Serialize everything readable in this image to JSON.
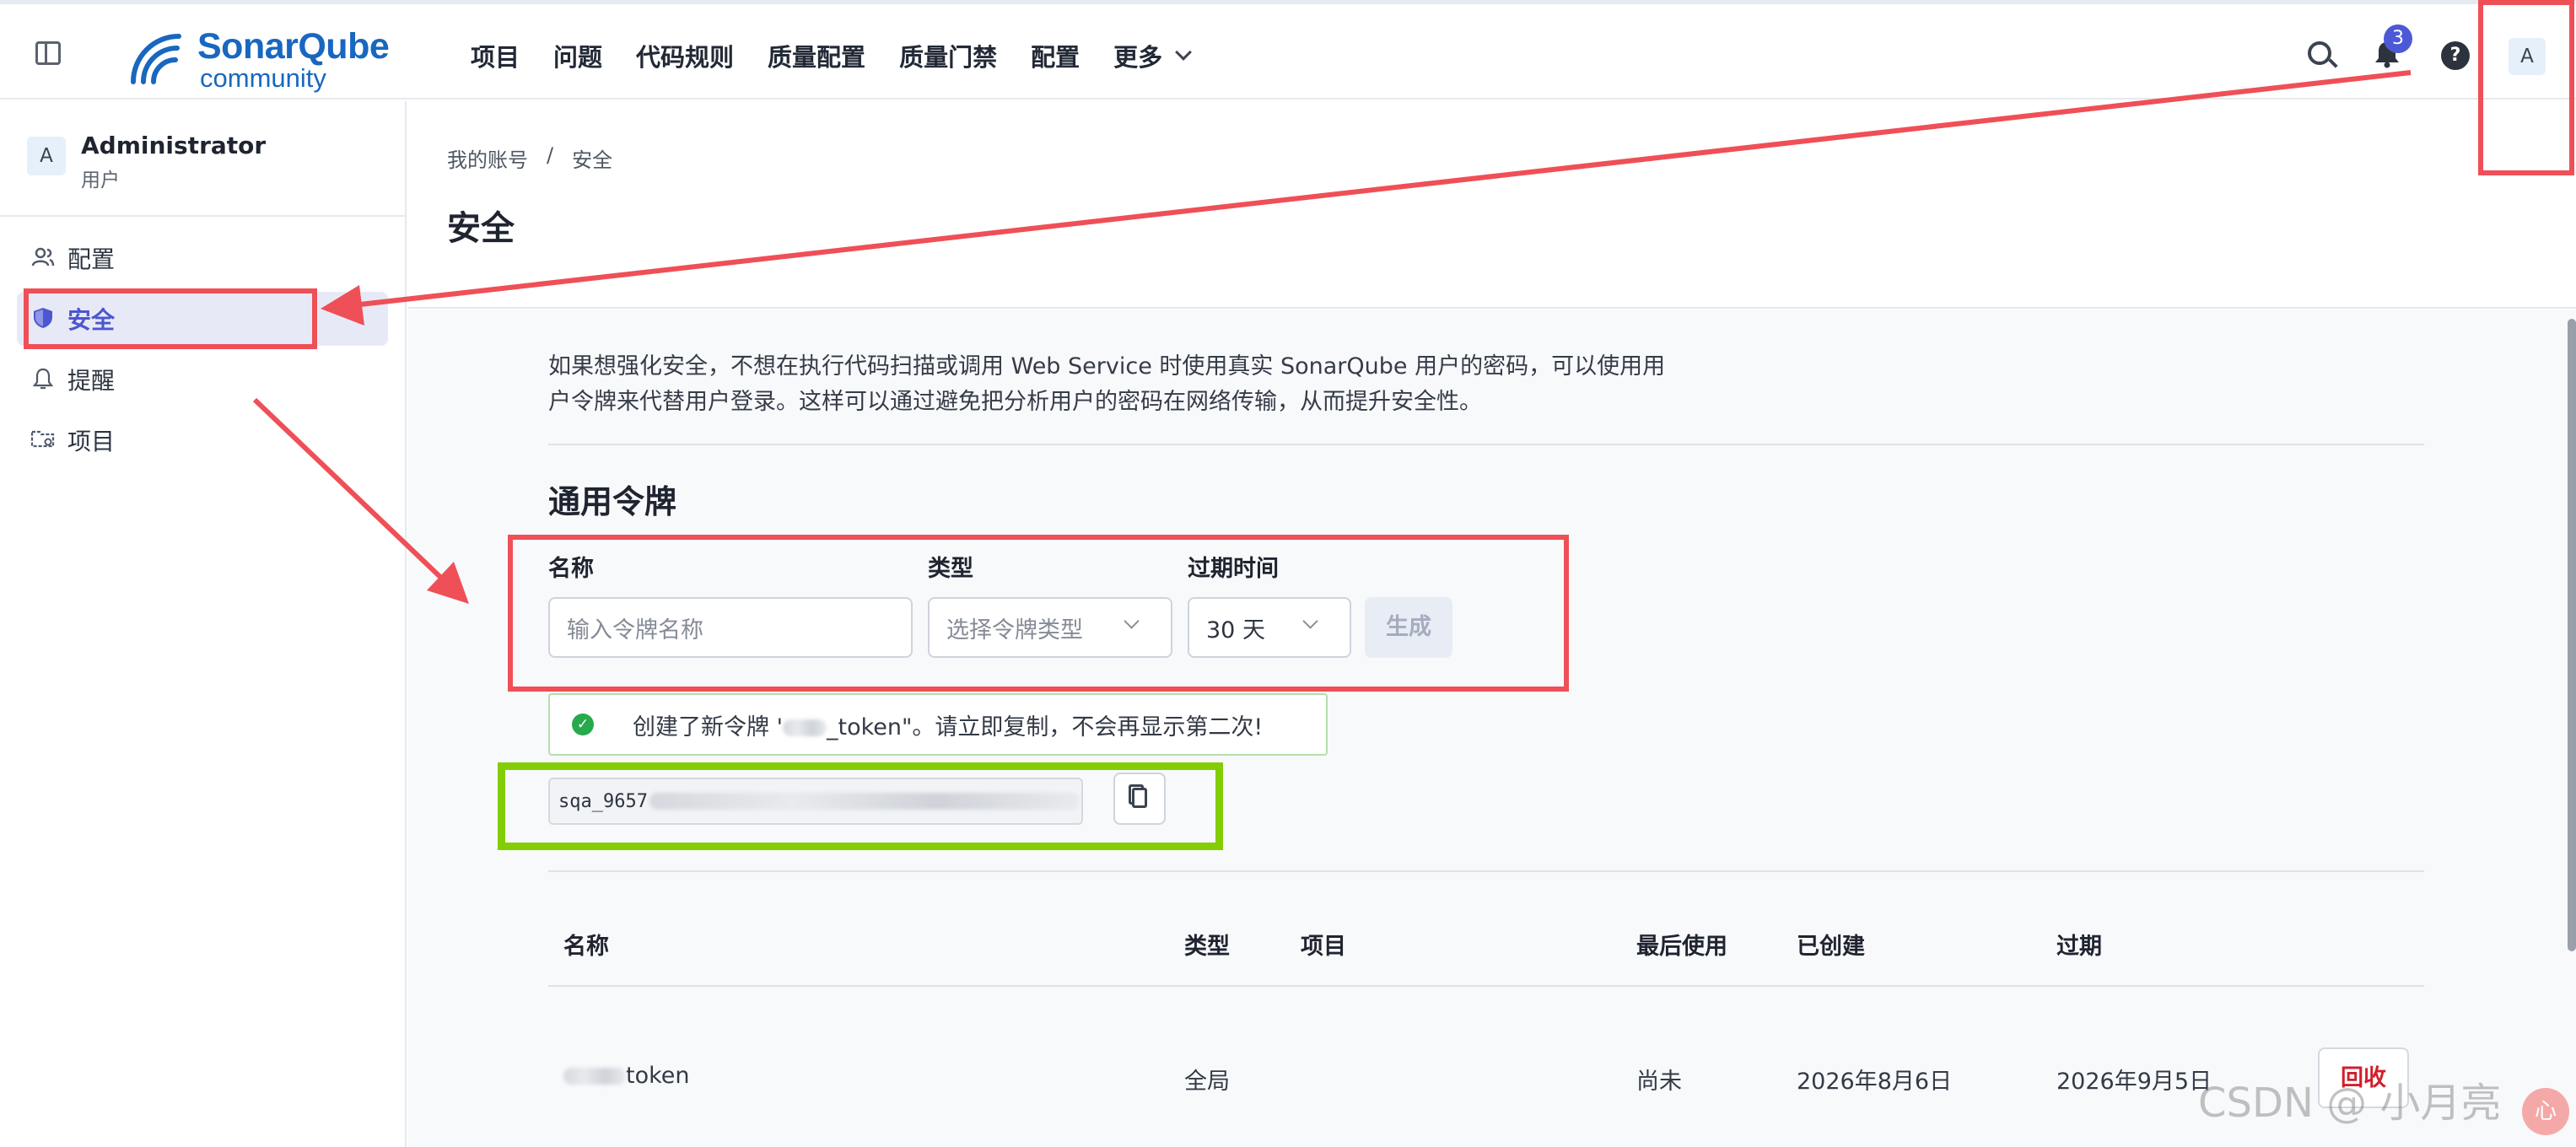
{
  "header": {
    "logo_name": "SonarQube",
    "logo_sub": "community",
    "nav": [
      "项目",
      "问题",
      "代码规则",
      "质量配置",
      "质量门禁",
      "配置"
    ],
    "nav_more": "更多",
    "notification_count": "3",
    "help_label": "?",
    "avatar_letter": "A"
  },
  "sidebar": {
    "avatar_letter": "A",
    "user_name": "Administrator",
    "user_role": "用户",
    "items": [
      {
        "label": "配置",
        "icon": "users-icon"
      },
      {
        "label": "安全",
        "icon": "shield-icon"
      },
      {
        "label": "提醒",
        "icon": "bell-icon"
      },
      {
        "label": "项目",
        "icon": "folder-icon"
      }
    ]
  },
  "breadcrumb": [
    "我的账号",
    "/",
    "安全"
  ],
  "page_title": "安全",
  "intro": "如果想强化安全，不想在执行代码扫描或调用 Web Service 时使用真实 SonarQube 用户的密码，可以使用用户令牌来代替用户登录。这样可以通过避免把分析用户的密码在网络传输，从而提升安全性。",
  "section_title": "通用令牌",
  "form": {
    "name_label": "名称",
    "name_placeholder": "输入令牌名称",
    "type_label": "类型",
    "type_placeholder": "选择令牌类型",
    "expiry_label": "过期时间",
    "expiry_value": "30 天",
    "generate_label": "生成"
  },
  "alert": {
    "prefix": "创建了新令牌 '",
    "suffix": "_token\"。请立即复制，不会再显示第二次!"
  },
  "token_value_prefix": "sqa_9657",
  "table": {
    "headers": [
      "名称",
      "类型",
      "项目",
      "最后使用",
      "已创建",
      "过期"
    ],
    "rows": [
      {
        "name_suffix": "token",
        "type": "全局",
        "project": "",
        "last_used": "尚未",
        "created": "2026年8月6日",
        "expires": "2026年9月5日",
        "action": "回收"
      }
    ]
  },
  "watermark": "CSDN @ 小月亮",
  "colors": {
    "brand": "#1867c0",
    "accent": "#4b56d0",
    "annotation_red": "#ef4f57",
    "annotation_green": "#83cd05",
    "success": "#27a94d",
    "danger": "#d0202c"
  }
}
